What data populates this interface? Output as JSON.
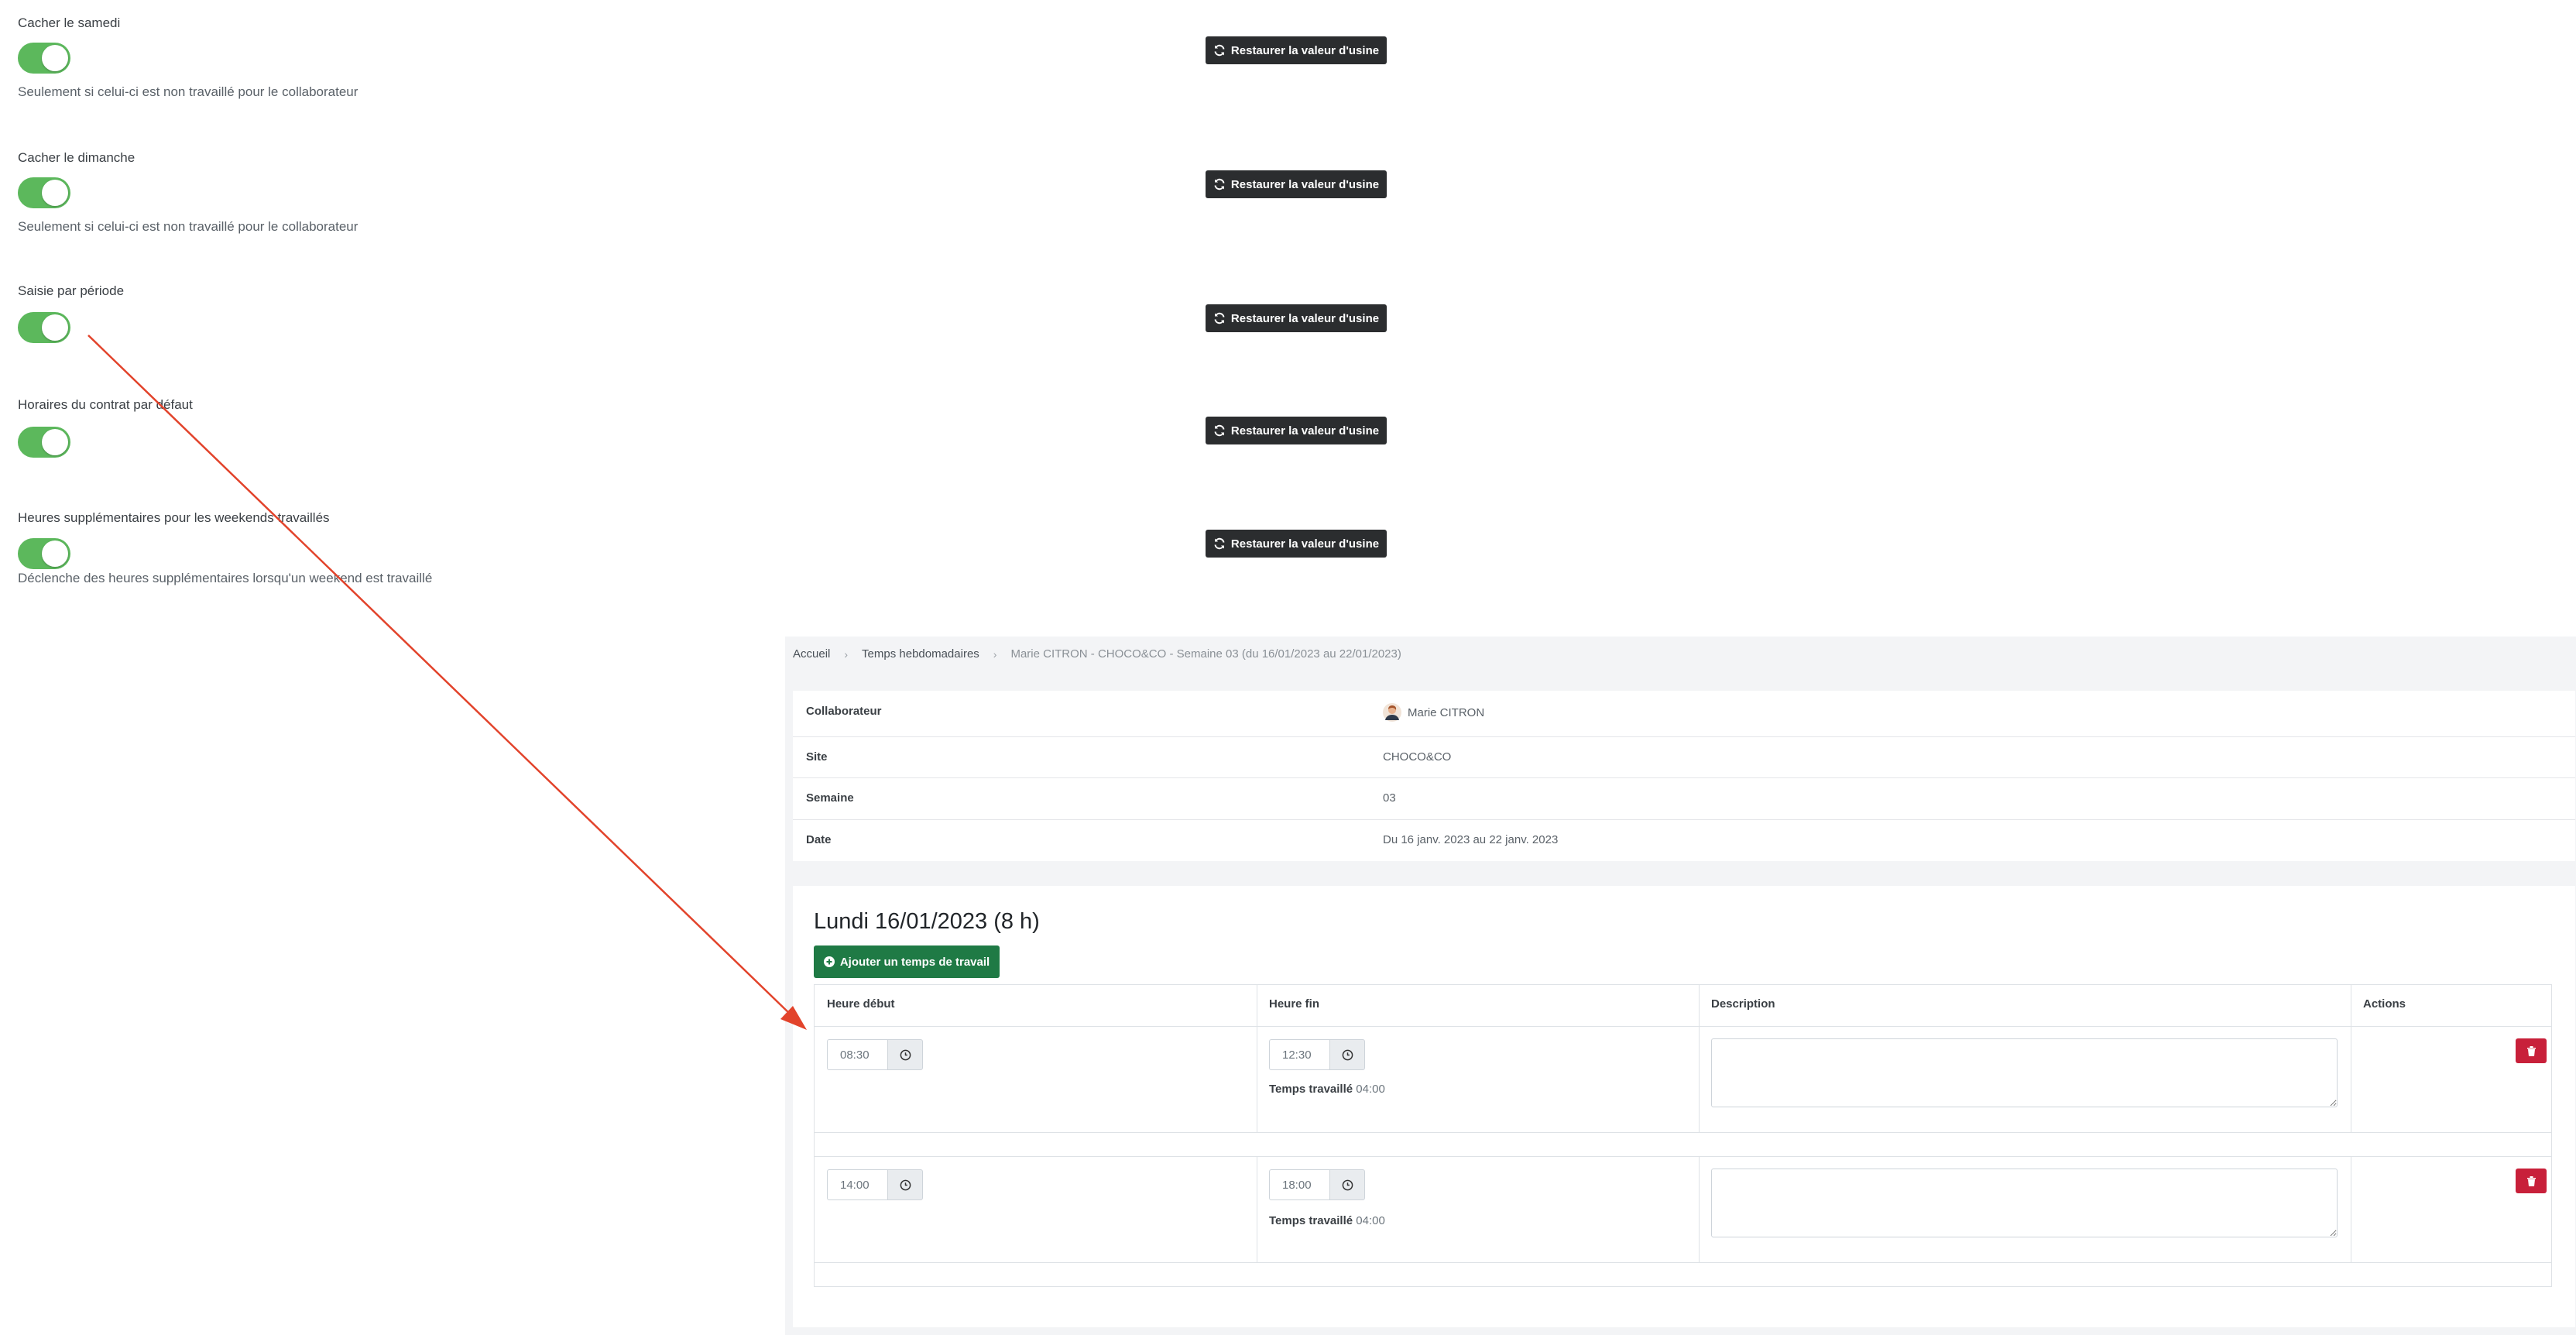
{
  "settings": [
    {
      "title": "Cacher le samedi",
      "help": "Seulement si celui-ci est non travaillé pour le collaborateur",
      "enabled": true
    },
    {
      "title": "Cacher le dimanche",
      "help": "Seulement si celui-ci est non travaillé pour le collaborateur",
      "enabled": true
    },
    {
      "title": "Saisie par période",
      "help": "",
      "enabled": true
    },
    {
      "title": "Horaires du contrat par défaut",
      "help": "",
      "enabled": true
    },
    {
      "title": "Heures supplémentaires pour les weekends travaillés",
      "help": "Déclenche des heures supplémentaires lorsqu'un weekend est travaillé",
      "enabled": true
    }
  ],
  "restore_label": "Restaurer la valeur d'usine",
  "breadcrumb": {
    "home": "Accueil",
    "section": "Temps hebdomadaires",
    "current": "Marie CITRON - CHOCO&CO - Semaine 03 (du 16/01/2023 au 22/01/2023)"
  },
  "info": {
    "rows": [
      {
        "label": "Collaborateur",
        "value": "Marie CITRON"
      },
      {
        "label": "Site",
        "value": "CHOCO&CO"
      },
      {
        "label": "Semaine",
        "value": "03"
      },
      {
        "label": "Date",
        "value": "Du 16 janv. 2023 au 22 janv. 2023"
      }
    ]
  },
  "day": {
    "title": "Lundi 16/01/2023 (8 h)",
    "add_label": "Ajouter un temps de travail",
    "columns": {
      "start": "Heure début",
      "end": "Heure fin",
      "description": "Description",
      "actions": "Actions"
    },
    "worked_label": "Temps travaillé",
    "entries": [
      {
        "start": "08:30",
        "end": "12:30",
        "worked": "04:00",
        "description": ""
      },
      {
        "start": "14:00",
        "end": "18:00",
        "worked": "04:00",
        "description": ""
      }
    ]
  },
  "colors": {
    "toggle_on": "#5cb85c",
    "restore_bg": "#2b2d2f",
    "add_bg": "#1f7a45",
    "delete_bg": "#c8203a",
    "arrow": "#e2432b"
  }
}
